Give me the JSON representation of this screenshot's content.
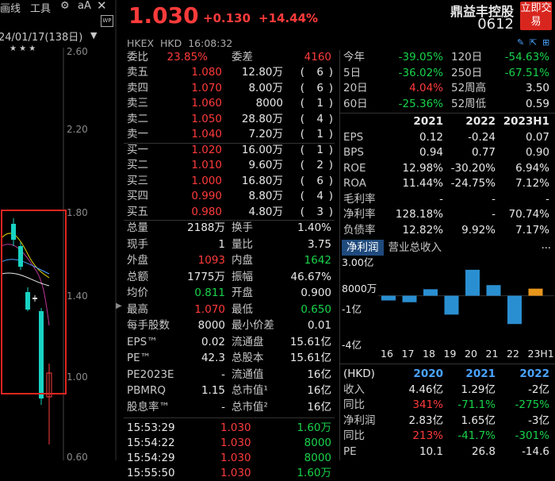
{
  "toolbar": {
    "draw_label": "画线",
    "tools_label": "工具",
    "wp_label": "WP"
  },
  "left": {
    "date_label": "24/01/17(138日)",
    "stars": "★  ★  ★",
    "yticks": [
      "2.60",
      "2.20",
      "1.80",
      "1.40",
      "1.00",
      "0.60"
    ]
  },
  "quote": {
    "price": "1.030",
    "change": "+0.130",
    "change_pct": "+14.44%",
    "name": "鼎益丰控股",
    "code": "0612",
    "trade_btn": "立即交易",
    "exchange": "HKEX",
    "currency": "HKD",
    "time": "16:08:32"
  },
  "colors": {
    "up": "#ff3b3b",
    "down": "#18d34a",
    "tab_active": "#1f4a7d",
    "bar": "#2a8fd1",
    "bar_forecast": "#e8961c",
    "trade_btn": "#d8261f"
  },
  "book": {
    "weibi_label": "委比",
    "weibi": "23.85%",
    "weicha_label": "委差",
    "weicha": "4160",
    "asks": [
      {
        "label": "卖五",
        "price": "1.080",
        "vol": "12.80万",
        "cnt": "6"
      },
      {
        "label": "卖四",
        "price": "1.070",
        "vol": "8.00万",
        "cnt": "6"
      },
      {
        "label": "卖三",
        "price": "1.060",
        "vol": "8000",
        "cnt": "1"
      },
      {
        "label": "卖二",
        "price": "1.050",
        "vol": "28.80万",
        "cnt": "4"
      },
      {
        "label": "卖一",
        "price": "1.040",
        "vol": "7.20万",
        "cnt": "1"
      }
    ],
    "bids": [
      {
        "label": "买一",
        "price": "1.020",
        "vol": "16.00万",
        "cnt": "1"
      },
      {
        "label": "买二",
        "price": "1.010",
        "vol": "9.60万",
        "cnt": "2"
      },
      {
        "label": "买三",
        "price": "1.000",
        "vol": "16.80万",
        "cnt": "6"
      },
      {
        "label": "买四",
        "price": "0.990",
        "vol": "8.80万",
        "cnt": "4"
      },
      {
        "label": "买五",
        "price": "0.980",
        "vol": "4.80万",
        "cnt": "3"
      }
    ]
  },
  "stats": [
    {
      "l1": "总量",
      "v1": "2188万",
      "l2": "换手",
      "v2": "1.40%"
    },
    {
      "l1": "现手",
      "v1": "1",
      "l2": "量比",
      "v2": "3.75"
    },
    {
      "l1": "外盘",
      "v1": "1093",
      "l2": "内盘",
      "v2": "1642"
    },
    {
      "l1": "总额",
      "v1": "1775万",
      "l2": "振幅",
      "v2": "46.67%"
    },
    {
      "l1": "均价",
      "v1": "0.811",
      "l2": "开盘",
      "v2": "0.900"
    },
    {
      "l1": "最高",
      "v1": "1.070",
      "l2": "最低",
      "v2": "0.650"
    },
    {
      "l1": "每手股数",
      "v1": "8000",
      "l2": "最小价差",
      "v2": "0.01"
    },
    {
      "l1": "EPS™",
      "v1": "0.02",
      "l2": "流通盘",
      "v2": "15.61亿"
    },
    {
      "l1": "PE™",
      "v1": "42.3",
      "l2": "总股本",
      "v2": "15.61亿"
    },
    {
      "l1": "PE2023E",
      "v1": "-",
      "l2": "流通值",
      "v2": "16亿"
    },
    {
      "l1": "PBMRQ",
      "v1": "1.15",
      "l2": "总市值¹",
      "v2": "16亿"
    },
    {
      "l1": "股息率™",
      "v1": "-",
      "l2": "总市值²",
      "v2": "16亿"
    }
  ],
  "ticks": [
    {
      "time": "15:53:29",
      "price": "1.030",
      "vol": "1.60万"
    },
    {
      "time": "15:54:22",
      "price": "1.030",
      "vol": "8000"
    },
    {
      "time": "15:54:29",
      "price": "1.030",
      "vol": "8000"
    },
    {
      "time": "15:55:50",
      "price": "1.030",
      "vol": "1.60万"
    }
  ],
  "perf": [
    {
      "l1": "今年",
      "v1": "-39.05%",
      "l2": "120日",
      "v2": "-54.63%"
    },
    {
      "l1": "5日",
      "v1": "-36.02%",
      "l2": "250日",
      "v2": "-67.51%"
    },
    {
      "l1": "20日",
      "v1": "4.04%",
      "l2": "52周高",
      "v2": "3.50"
    },
    {
      "l1": "60日",
      "v1": "-25.36%",
      "l2": "52周低",
      "v2": "0.59"
    }
  ],
  "fin": {
    "years": [
      "2021",
      "2022",
      "2023H1"
    ],
    "rows": [
      {
        "label": "EPS",
        "vals": [
          "0.12",
          "-0.24",
          "0.07"
        ]
      },
      {
        "label": "BPS",
        "vals": [
          "0.94",
          "0.77",
          "0.90"
        ]
      },
      {
        "label": "ROE",
        "vals": [
          "12.98%",
          "-30.20%",
          "6.94%"
        ]
      },
      {
        "label": "ROA",
        "vals": [
          "11.44%",
          "-24.75%",
          "7.12%"
        ]
      },
      {
        "label": "毛利率",
        "vals": [
          "-",
          "-",
          "-"
        ]
      },
      {
        "label": "净利率",
        "vals": [
          "128.18%",
          "-",
          "70.74%"
        ]
      },
      {
        "label": "负债率",
        "vals": [
          "12.82%",
          "9.92%",
          "7.17%"
        ]
      }
    ]
  },
  "profit_chart": {
    "tabs": [
      "净利润",
      "营业总收入"
    ],
    "more": "...",
    "chart_data": {
      "type": "bar",
      "categories": [
        "16",
        "17",
        "18",
        "19",
        "20",
        "21",
        "22",
        "23H1"
      ],
      "values": [
        -0.4,
        -0.55,
        0.55,
        -1.6,
        2.2,
        0.9,
        -2.4,
        0.6
      ],
      "yticks": [
        "3.00亿",
        "8000万",
        "-1亿",
        "-4亿"
      ],
      "ylim": [
        -4,
        3
      ]
    }
  },
  "annual": {
    "header": [
      "(HKD)",
      "2020",
      "2021",
      "2022"
    ],
    "rows": [
      {
        "label": "收入",
        "vals": [
          "4.46亿",
          "1.29亿",
          "-2亿"
        ]
      },
      {
        "label": "同比",
        "vals": [
          "341%",
          "-71.1%",
          "-275%"
        ]
      },
      {
        "label": "净利润",
        "vals": [
          "2.83亿",
          "1.65亿",
          "-3亿"
        ]
      },
      {
        "label": "同比",
        "vals": [
          "213%",
          "-41.7%",
          "-301%"
        ]
      },
      {
        "label": "PE",
        "vals": [
          "10.1",
          "26.8",
          "-14.6"
        ]
      }
    ]
  }
}
